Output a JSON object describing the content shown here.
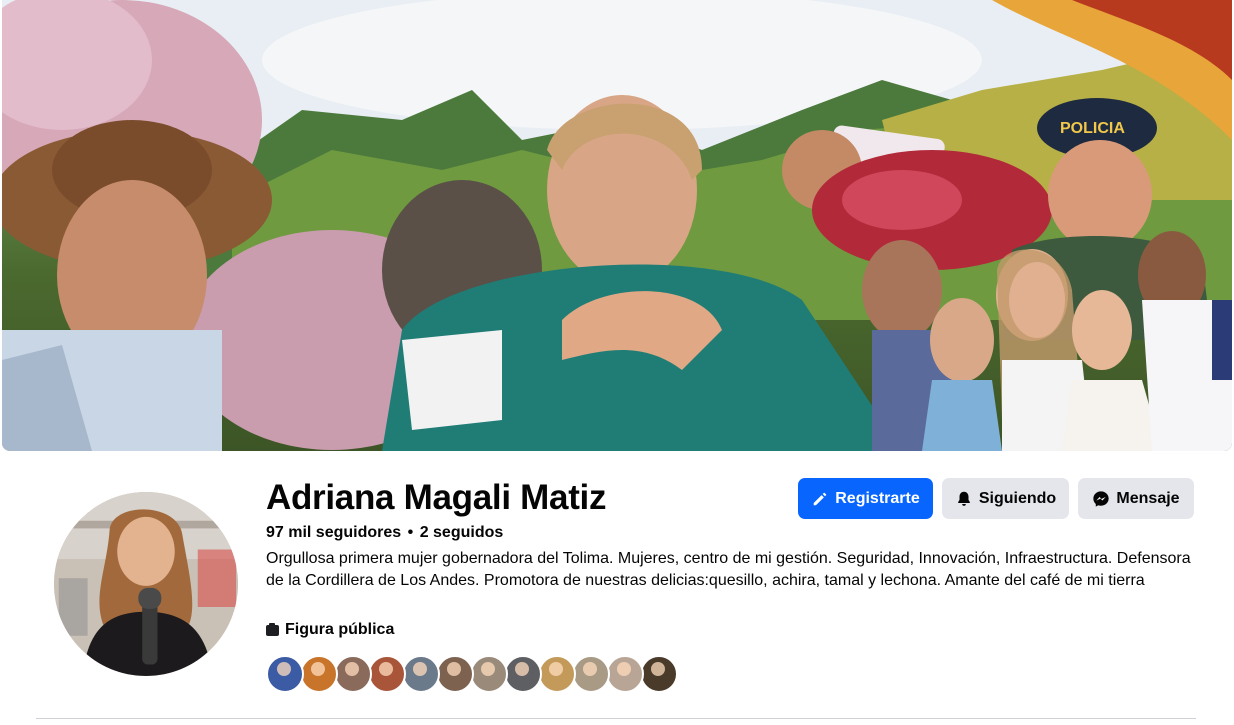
{
  "profile": {
    "name": "Adriana Magali Matiz",
    "followers": "97 mil seguidores",
    "separator": "•",
    "following": "2 seguidos",
    "bio": "Orgullosa primera mujer gobernadora del Tolima. Mujeres, centro de mi gestión. Seguridad, Innovación, Infraestructura. Defensora de la Cordillera de Los Andes. Promotora de nuestras delicias:quesillo, achira, tamal y lechona. Amante del café de mi tierra",
    "category": "Figura pública",
    "category_icon": "briefcase-icon"
  },
  "cover": {
    "police_cap_text": "POLICIA"
  },
  "actions": {
    "register_label": "Registrarte",
    "register_icon": "pencil-icon",
    "following_label": "Siguiendo",
    "following_icon": "bell-icon",
    "message_label": "Mensaje",
    "message_icon": "messenger-icon"
  },
  "colors": {
    "primary": "#0866ff",
    "secondary_button": "#e4e6eb",
    "text": "#050505"
  },
  "friend_avatars": [
    {
      "color": "#3b5ba5"
    },
    {
      "color": "#c8742a"
    },
    {
      "color": "#8a6a5a"
    },
    {
      "color": "#a8553a"
    },
    {
      "color": "#6b7a8a"
    },
    {
      "color": "#7d6250"
    },
    {
      "color": "#9a8a7a"
    },
    {
      "color": "#5d5f63"
    },
    {
      "color": "#c49a5a"
    },
    {
      "color": "#a89a85"
    },
    {
      "color": "#b8a595"
    },
    {
      "color": "#4a3a2a"
    }
  ]
}
